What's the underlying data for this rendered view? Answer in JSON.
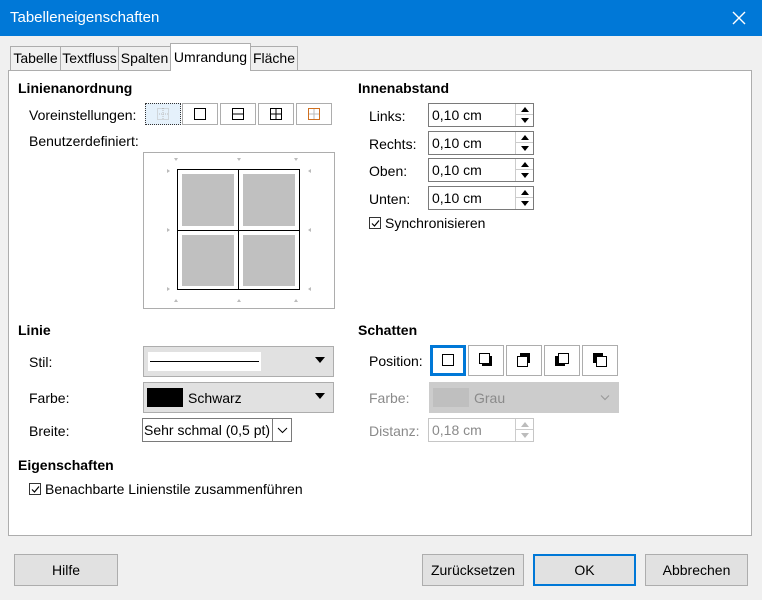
{
  "window": {
    "title": "Tabelleneigenschaften"
  },
  "tabs": [
    {
      "label": "Tabelle"
    },
    {
      "label": "Textfluss"
    },
    {
      "label": "Spalten"
    },
    {
      "label": "Umrandung",
      "active": true
    },
    {
      "label": "Fläche"
    }
  ],
  "line_arrangement": {
    "title": "Linienanordnung",
    "presets_label": "Voreinstellungen:",
    "user_defined_label": "Benutzerdefiniert:"
  },
  "padding": {
    "title": "Innenabstand",
    "left_label": "Links:",
    "left_value": "0,10 cm",
    "right_label": "Rechts:",
    "right_value": "0,10 cm",
    "top_label": "Oben:",
    "top_value": "0,10 cm",
    "bottom_label": "Unten:",
    "bottom_value": "0,10 cm",
    "sync_label": "Synchronisieren",
    "sync_checked": true
  },
  "line": {
    "title": "Linie",
    "style_label": "Stil:",
    "color_label": "Farbe:",
    "color_value": "Schwarz",
    "color_hex": "#000000",
    "width_label": "Breite:",
    "width_value": "Sehr schmal (0,5 pt)"
  },
  "shadow": {
    "title": "Schatten",
    "position_label": "Position:",
    "color_label": "Farbe:",
    "color_value": "Grau",
    "color_hex": "#c0c0c0",
    "distance_label": "Distanz:",
    "distance_value": "0,18 cm"
  },
  "properties": {
    "title": "Eigenschaften",
    "merge_label": "Benachbarte Linienstile zusammenführen",
    "merge_checked": true
  },
  "buttons": {
    "help": "Hilfe",
    "reset": "Zurücksetzen",
    "ok": "OK",
    "cancel": "Abbrechen"
  },
  "accent_color": "#0078d7"
}
